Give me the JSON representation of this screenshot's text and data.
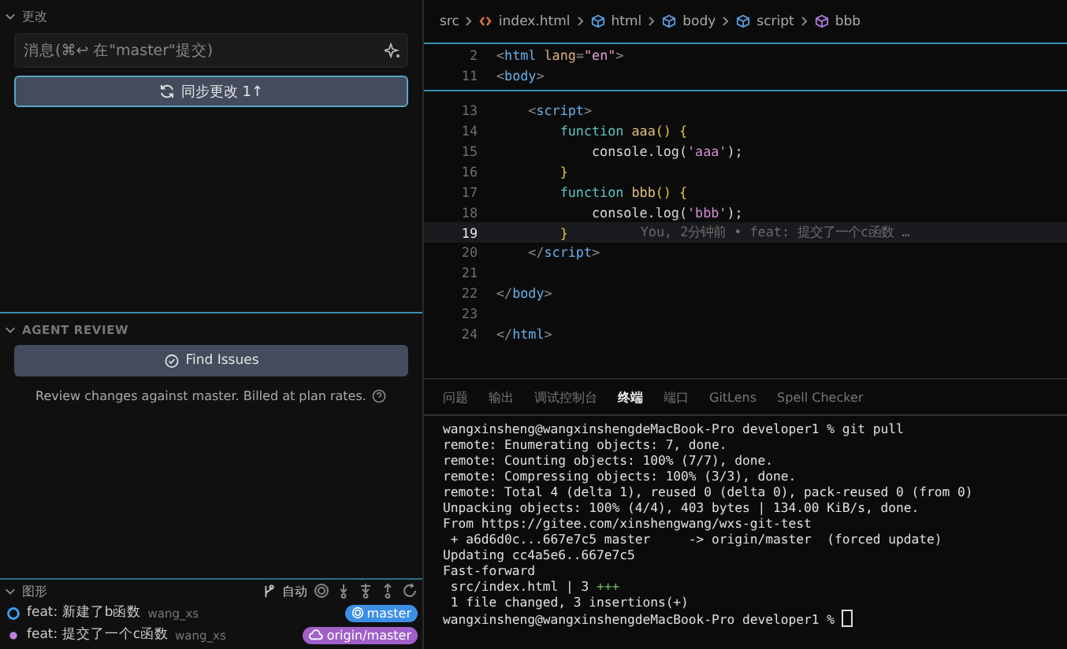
{
  "scm": {
    "section_title": "更改",
    "commit_placeholder": "消息(⌘↩ 在\"master\"提交)",
    "sync_button": "同步更改 1↑"
  },
  "agent_review": {
    "section_title": "AGENT REVIEW",
    "button": "Find Issues",
    "note": "Review changes against master. Billed at plan rates."
  },
  "graph": {
    "section_title": "图形",
    "auto_label": "自动",
    "commits": [
      {
        "message": "feat: 新建了b函数",
        "author": "wang_xs",
        "ref": "master",
        "kind": "local",
        "head": true
      },
      {
        "message": "feat: 提交了一个c函数",
        "author": "wang_xs",
        "ref": "origin/master",
        "kind": "remote",
        "head": false
      }
    ]
  },
  "breadcrumb": [
    {
      "label": "src",
      "kind": "folder"
    },
    {
      "label": "index.html",
      "kind": "file"
    },
    {
      "label": "html",
      "kind": "element"
    },
    {
      "label": "body",
      "kind": "element"
    },
    {
      "label": "script",
      "kind": "element"
    },
    {
      "label": "bbb",
      "kind": "function"
    }
  ],
  "sticky_lines": [
    {
      "number": "2",
      "tokens": [
        {
          "text": "<",
          "kind": "punct"
        },
        {
          "text": "html",
          "kind": "tag"
        },
        {
          "text": " lang",
          "kind": "attr"
        },
        {
          "text": "=",
          "kind": "punct"
        },
        {
          "text": "\"en\"",
          "kind": "string"
        },
        {
          "text": ">",
          "kind": "punct"
        }
      ]
    },
    {
      "number": "11",
      "tokens": [
        {
          "text": "<",
          "kind": "punct"
        },
        {
          "text": "body",
          "kind": "tag"
        },
        {
          "text": ">",
          "kind": "punct"
        }
      ]
    }
  ],
  "lines": [
    {
      "number": "13",
      "current": false,
      "tokens": [
        {
          "text": "    <",
          "kind": "punct"
        },
        {
          "text": "script",
          "kind": "tag"
        },
        {
          "text": ">",
          "kind": "punct"
        }
      ]
    },
    {
      "number": "14",
      "current": false,
      "tokens": [
        {
          "text": "        function",
          "kind": "keyword"
        },
        {
          "text": " aaa",
          "kind": "func"
        },
        {
          "text": "() {",
          "kind": "brace"
        }
      ]
    },
    {
      "number": "15",
      "current": false,
      "tokens": [
        {
          "text": "            console.log(",
          "kind": "plain"
        },
        {
          "text": "'aaa'",
          "kind": "string2"
        },
        {
          "text": ");",
          "kind": "plain"
        }
      ]
    },
    {
      "number": "16",
      "current": false,
      "tokens": [
        {
          "text": "        }",
          "kind": "brace"
        }
      ]
    },
    {
      "number": "17",
      "current": false,
      "tokens": [
        {
          "text": "        function",
          "kind": "keyword"
        },
        {
          "text": " bbb",
          "kind": "func"
        },
        {
          "text": "() {",
          "kind": "brace"
        }
      ]
    },
    {
      "number": "18",
      "current": false,
      "tokens": [
        {
          "text": "            console.log(",
          "kind": "plain"
        },
        {
          "text": "'bbb'",
          "kind": "string2"
        },
        {
          "text": ");",
          "kind": "plain"
        }
      ]
    },
    {
      "number": "19",
      "current": true,
      "tokens": [
        {
          "text": "        }",
          "kind": "brace"
        }
      ],
      "blame": "You, 2分钟前 • feat: 提交了一个c函数 …"
    },
    {
      "number": "20",
      "current": false,
      "tokens": [
        {
          "text": "    </",
          "kind": "punct"
        },
        {
          "text": "script",
          "kind": "tag"
        },
        {
          "text": ">",
          "kind": "punct"
        }
      ]
    },
    {
      "number": "21",
      "current": false
    },
    {
      "number": "22",
      "current": false,
      "tokens": [
        {
          "text": "</",
          "kind": "punct"
        },
        {
          "text": "body",
          "kind": "tag"
        },
        {
          "text": ">",
          "kind": "punct"
        }
      ]
    },
    {
      "number": "23",
      "current": false
    },
    {
      "number": "24",
      "current": false,
      "tokens": [
        {
          "text": "</",
          "kind": "punct"
        },
        {
          "text": "html",
          "kind": "tag"
        },
        {
          "text": ">",
          "kind": "punct"
        }
      ]
    }
  ],
  "panel_tabs": [
    {
      "label": "问题",
      "selected": false
    },
    {
      "label": "输出",
      "selected": false
    },
    {
      "label": "调试控制台",
      "selected": false
    },
    {
      "label": "终端",
      "selected": true
    },
    {
      "label": "端口",
      "selected": false
    },
    {
      "label": "GitLens",
      "selected": false
    },
    {
      "label": "Spell Checker",
      "selected": false
    }
  ],
  "terminal": [
    {
      "kind": "output",
      "text": "wangxinsheng@wangxinshengdeMacBook-Pro developer1 % git pull"
    },
    {
      "kind": "output",
      "text": "remote: Enumerating objects: 7, done."
    },
    {
      "kind": "output",
      "text": "remote: Counting objects: 100% (7/7), done."
    },
    {
      "kind": "output",
      "text": "remote: Compressing objects: 100% (3/3), done."
    },
    {
      "kind": "output",
      "text": "remote: Total 4 (delta 1), reused 0 (delta 0), pack-reused 0 (from 0)"
    },
    {
      "kind": "output",
      "text": "Unpacking objects: 100% (4/4), 403 bytes | 134.00 KiB/s, done."
    },
    {
      "kind": "output",
      "text": "From https://gitee.com/xinshengwang/wxs-git-test"
    },
    {
      "kind": "output",
      "text": " + a6d6d0c...667e7c5 master     -> origin/master  (forced update)"
    },
    {
      "kind": "output",
      "text": "Updating cc4a5e6..667e7c5"
    },
    {
      "kind": "output",
      "text": "Fast-forward"
    },
    {
      "kind": "diffstat",
      "text": " src/index.html | 3 ",
      "added": "+++"
    },
    {
      "kind": "output",
      "text": " 1 file changed, 3 insertions(+)"
    },
    {
      "kind": "prompt",
      "text": "wangxinsheng@wangxinshengdeMacBook-Pro developer1 % "
    }
  ]
}
